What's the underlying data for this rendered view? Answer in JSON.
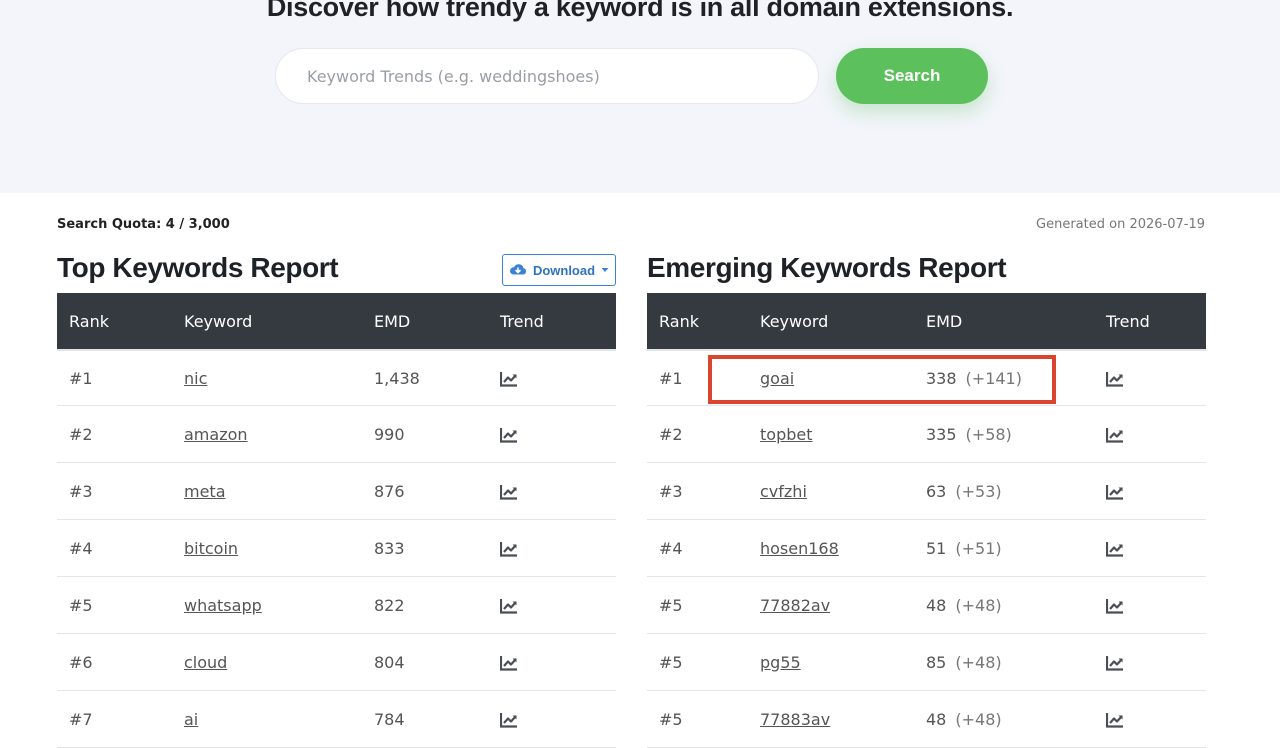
{
  "hero": {
    "title": "Discover how trendy a keyword is in all domain extensions.",
    "search_placeholder": "Keyword Trends (e.g. weddingshoes)",
    "search_value": "",
    "search_button": "Search"
  },
  "meta": {
    "quota": "Search Quota: 4 / 3,000",
    "generated": "Generated on 2026-07-19"
  },
  "top_report": {
    "title": "Top Keywords Report",
    "download_label": "Download",
    "columns": [
      "Rank",
      "Keyword",
      "EMD",
      "Trend"
    ],
    "rows": [
      {
        "rank": "#1",
        "keyword": "nic",
        "emd": "1,438"
      },
      {
        "rank": "#2",
        "keyword": "amazon",
        "emd": "990"
      },
      {
        "rank": "#3",
        "keyword": "meta",
        "emd": "876"
      },
      {
        "rank": "#4",
        "keyword": "bitcoin",
        "emd": "833"
      },
      {
        "rank": "#5",
        "keyword": "whatsapp",
        "emd": "822"
      },
      {
        "rank": "#6",
        "keyword": "cloud",
        "emd": "804"
      },
      {
        "rank": "#7",
        "keyword": "ai",
        "emd": "784"
      }
    ]
  },
  "emerging_report": {
    "title": "Emerging Keywords Report",
    "columns": [
      "Rank",
      "Keyword",
      "EMD",
      "Trend"
    ],
    "rows": [
      {
        "rank": "#1",
        "keyword": "goai",
        "emd": "338",
        "delta": "(+141)"
      },
      {
        "rank": "#2",
        "keyword": "topbet",
        "emd": "335",
        "delta": "(+58)"
      },
      {
        "rank": "#3",
        "keyword": "cvfzhi",
        "emd": "63",
        "delta": "(+53)"
      },
      {
        "rank": "#4",
        "keyword": "hosen168",
        "emd": "51",
        "delta": "(+51)"
      },
      {
        "rank": "#5",
        "keyword": "77882av",
        "emd": "48",
        "delta": "(+48)"
      },
      {
        "rank": "#5",
        "keyword": "pg55",
        "emd": "85",
        "delta": "(+48)"
      },
      {
        "rank": "#5",
        "keyword": "77883av",
        "emd": "48",
        "delta": "(+48)"
      }
    ]
  },
  "icons": {
    "trend": "line-chart-icon",
    "download": "cloud-download-icon",
    "caret": "caret-down-icon"
  },
  "colors": {
    "search_button": "#5cc05c",
    "table_header": "#343a40",
    "download_border": "#3a83d4",
    "highlight": "#d9452e"
  }
}
